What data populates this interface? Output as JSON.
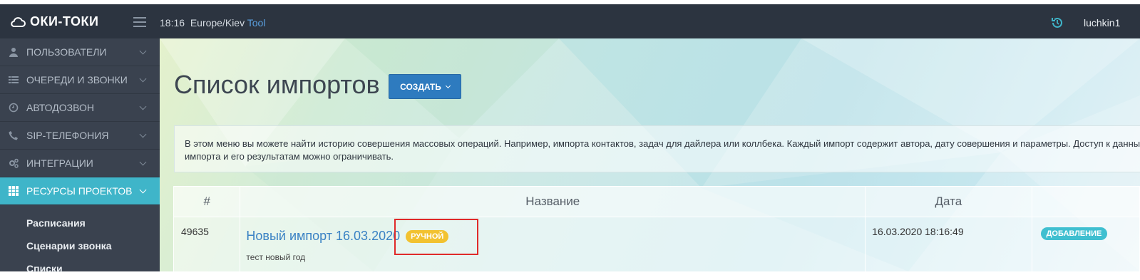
{
  "topbar": {
    "logo_text": "ОКИ-ТОКИ",
    "time": "18:16",
    "timezone": "Europe/Kiev",
    "tool_label": "Tool",
    "user": "luchkin1"
  },
  "sidebar": {
    "items": [
      {
        "label": "ПОЛЬЗОВАТЕЛИ",
        "icon": "user-icon"
      },
      {
        "label": "ОЧЕРЕДИ И ЗВОНКИ",
        "icon": "list-icon"
      },
      {
        "label": "АВТОДОЗВОН",
        "icon": "clock-icon"
      },
      {
        "label": "SIP-ТЕЛЕФОНИЯ",
        "icon": "phone-icon"
      },
      {
        "label": "ИНТЕГРАЦИИ",
        "icon": "gears-icon"
      },
      {
        "label": "РЕСУРСЫ ПРОЕКТОВ",
        "icon": "grid-icon"
      }
    ],
    "subitems": [
      "Расписания",
      "Сценарии звонка",
      "Списки"
    ]
  },
  "main": {
    "title": "Список импортов",
    "create_label": "СОЗДАТЬ",
    "info_text": "В этом меню вы можете найти историю совершения массовых операций. Например, импорта контактов, задач для дайлера или коллбека. Каждый импорт содержит автора, дату совершения и параметры. Доступ к данным импорта и его результатам можно ограничивать.",
    "table": {
      "headers": [
        "#",
        "Название",
        "Дата",
        ""
      ],
      "rows": [
        {
          "id": "49635",
          "name": "Новый импорт 16.03.2020",
          "badge": "РУЧНОЙ",
          "description": "тест новый год",
          "date": "16.03.2020 18:16:49",
          "type": "ДОБАВЛЕНИЕ"
        }
      ]
    }
  },
  "colors": {
    "topbar": "#2c3440",
    "sidebar": "#3a424f",
    "active": "#3fb5c9",
    "primary": "#2e7bbf",
    "badge_manual": "#f2c230",
    "badge_type": "#3fbfd0",
    "highlight": "#e02a2a"
  }
}
